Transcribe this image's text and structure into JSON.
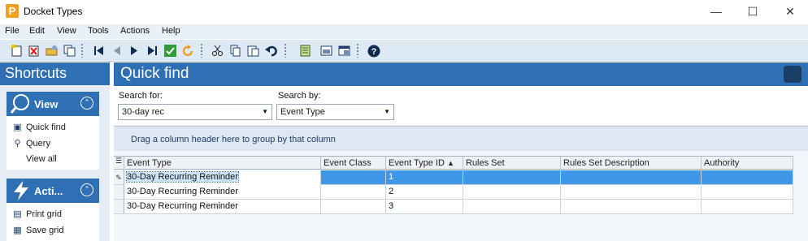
{
  "window": {
    "title": "Docket Types",
    "app_icon": "P"
  },
  "menu": [
    "File",
    "Edit",
    "View",
    "Tools",
    "Actions",
    "Help"
  ],
  "toolbar_icons": [
    "new-icon",
    "delete-icon",
    "open-icon",
    "copy-record-icon",
    "first-record-icon",
    "previous-record-icon",
    "next-record-icon",
    "last-record-icon",
    "save-check-icon",
    "refresh-icon",
    "cut-icon",
    "copy-icon",
    "paste-icon",
    "undo-icon",
    "notes-icon",
    "print-preview-icon",
    "layout-icon",
    "help-icon"
  ],
  "sidebar": {
    "title": "Shortcuts",
    "view_panel": {
      "title": "View",
      "items": [
        "Quick find",
        "Query",
        "View all"
      ]
    },
    "actions_panel": {
      "title": "Acti...",
      "items": [
        "Print grid",
        "Save grid"
      ]
    }
  },
  "main": {
    "title": "Quick find",
    "search_for_label": "Search for:",
    "search_for_value": "30-day rec",
    "search_by_label": "Search by:",
    "search_by_value": "Event Type",
    "group_hint": "Drag a column header here to group by that column"
  },
  "grid": {
    "columns": [
      "Event Type",
      "Event Class",
      "Event Type ID",
      "Rules Set",
      "Rules Set Description",
      "Authority"
    ],
    "sort_column": "Event Type ID",
    "sort_indicator": "▲",
    "rows": [
      [
        "30-Day Recurring Reminder",
        "",
        "1",
        "",
        "",
        ""
      ],
      [
        "30-Day Recurring Reminder",
        "",
        "2",
        "",
        "",
        ""
      ],
      [
        "30-Day Recurring Reminder",
        "",
        "3",
        "",
        "",
        ""
      ]
    ],
    "selected_row": 0,
    "selection_color": "#3f97e8"
  },
  "colors": {
    "accent": "#2f6fb3",
    "toolbar": "#dde9f5"
  }
}
